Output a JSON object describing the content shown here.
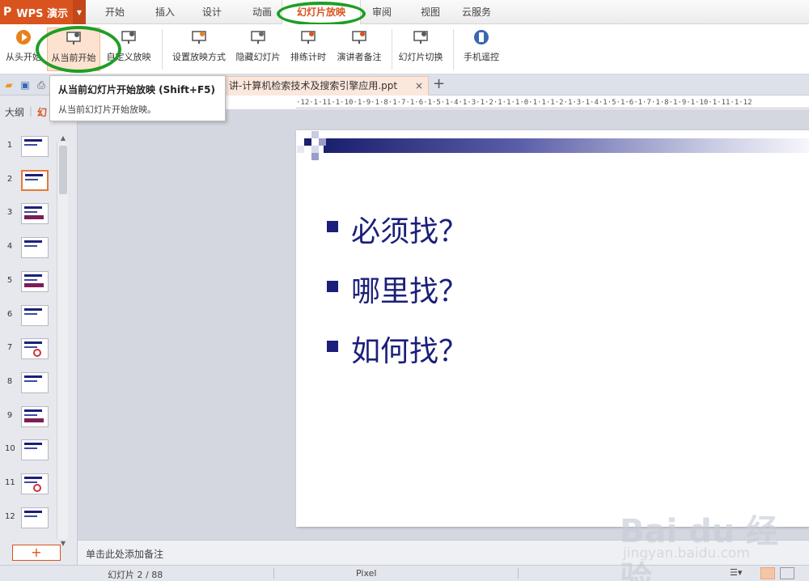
{
  "app": {
    "logo": "P",
    "name": "WPS 演示"
  },
  "menu": {
    "tabs": [
      "开始",
      "插入",
      "设计",
      "动画",
      "幻灯片放映",
      "审阅",
      "视图",
      "云服务"
    ],
    "active_index": 4
  },
  "ribbon": {
    "buttons": [
      {
        "label": "从头开始",
        "icon": "play-circle-icon"
      },
      {
        "label": "从当前开始",
        "icon": "play-from-current-icon"
      },
      {
        "label": "自定义放映",
        "icon": "custom-show-icon"
      },
      {
        "label": "设置放映方式",
        "icon": "show-settings-icon"
      },
      {
        "label": "隐藏幻灯片",
        "icon": "hide-slide-icon"
      },
      {
        "label": "排练计时",
        "icon": "rehearse-timing-icon"
      },
      {
        "label": "演讲者备注",
        "icon": "speaker-notes-icon"
      },
      {
        "label": "幻灯片切换",
        "icon": "slide-transition-icon"
      },
      {
        "label": "手机遥控",
        "icon": "phone-remote-icon"
      }
    ],
    "pressed_index": 1
  },
  "tooltip": {
    "title": "从当前幻灯片开始放映 (Shift+F5)",
    "description": "从当前幻灯片开始放映。"
  },
  "doc_tab": {
    "title": "讲-计算机检索技术及搜索引擎应用.ppt",
    "close": "×",
    "new_tab": "+"
  },
  "left_panel": {
    "tab_outline": "大纲",
    "tab_slides": "幻",
    "slide_numbers": [
      "1",
      "2",
      "3",
      "4",
      "5",
      "6",
      "7",
      "8",
      "9",
      "10",
      "11",
      "12"
    ],
    "selected_index": 1,
    "add_button": "+"
  },
  "ruler": {
    "text": "·12·1·11·1·10·1·9·1·8·1·7·1·6·1·5·1·4·1·3·1·2·1·1·1·0·1·1·1·2·1·3·1·4·1·5·1·6·1·7·1·8·1·9·1·10·1·11·1·12"
  },
  "slide": {
    "bullets": [
      "必须找？",
      "哪里找？",
      "如何找？"
    ],
    "text_color": "#1b1f7a"
  },
  "notes": {
    "placeholder": "单击此处添加备注"
  },
  "status": {
    "slide_info": "幻灯片 2 / 88",
    "theme": "Pixel"
  },
  "watermark": {
    "brand": "Bai du 经验",
    "url": "jingyan.baidu.com"
  },
  "colors": {
    "accent": "#d9531e",
    "highlight_circle": "#1e9e25"
  }
}
